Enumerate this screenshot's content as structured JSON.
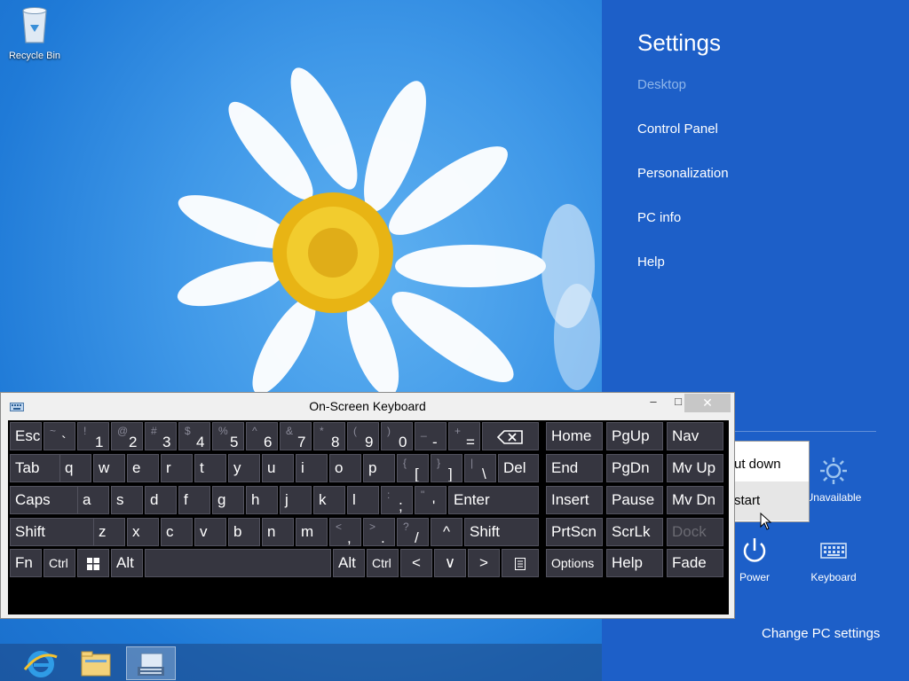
{
  "desktop": {
    "recycle_bin_label": "Recycle Bin"
  },
  "taskbar": {
    "items": [
      {
        "name": "internet-explorer",
        "icon": "ie-icon"
      },
      {
        "name": "file-explorer",
        "icon": "folder-icon"
      },
      {
        "name": "on-screen-keyboard",
        "icon": "keyboard-app-icon",
        "active": true
      }
    ]
  },
  "settings": {
    "title": "Settings",
    "context": "Desktop",
    "links": [
      "Control Panel",
      "Personalization",
      "PC info",
      "Help"
    ],
    "network_label": "Unavailable",
    "power_label": "Power",
    "keyboard_label": "Keyboard",
    "change_pc_settings": "Change PC settings",
    "accent_color": "#1d5fc8"
  },
  "power_menu": {
    "items": [
      "ut down",
      "start"
    ]
  },
  "osk": {
    "title": "On-Screen Keyboard",
    "minimize": "–",
    "maximize": "□",
    "close": "✕",
    "rows": [
      [
        {
          "t": "Esc"
        },
        {
          "s": "~",
          "m": "`"
        },
        {
          "s": "!",
          "m": "1"
        },
        {
          "s": "@",
          "m": "2"
        },
        {
          "s": "#",
          "m": "3"
        },
        {
          "s": "$",
          "m": "4"
        },
        {
          "s": "%",
          "m": "5"
        },
        {
          "s": "^",
          "m": "6"
        },
        {
          "s": "&",
          "m": "7"
        },
        {
          "s": "*",
          "m": "8"
        },
        {
          "s": "(",
          "m": "9"
        },
        {
          "s": ")",
          "m": "0"
        },
        {
          "s": "_",
          "m": "-"
        },
        {
          "s": "+",
          "m": "="
        },
        {
          "icon": "backspace-icon"
        },
        {
          "t": "Home"
        },
        {
          "t": "PgUp"
        },
        {
          "t": "Nav"
        }
      ],
      [
        {
          "t": "Tab"
        },
        {
          "t": "q"
        },
        {
          "t": "w"
        },
        {
          "t": "e"
        },
        {
          "t": "r"
        },
        {
          "t": "t"
        },
        {
          "t": "y"
        },
        {
          "t": "u"
        },
        {
          "t": "i"
        },
        {
          "t": "o"
        },
        {
          "t": "p"
        },
        {
          "s": "{",
          "m": "["
        },
        {
          "s": "}",
          "m": "]"
        },
        {
          "s": "|",
          "m": "\\"
        },
        {
          "t": "Del"
        },
        {
          "t": "End"
        },
        {
          "t": "PgDn"
        },
        {
          "t": "Mv Up"
        }
      ],
      [
        {
          "t": "Caps"
        },
        {
          "t": "a"
        },
        {
          "t": "s"
        },
        {
          "t": "d"
        },
        {
          "t": "f"
        },
        {
          "t": "g"
        },
        {
          "t": "h"
        },
        {
          "t": "j"
        },
        {
          "t": "k"
        },
        {
          "t": "l"
        },
        {
          "s": ":",
          "m": ";"
        },
        {
          "s": "\"",
          "m": "'"
        },
        {
          "t": "Enter"
        },
        {
          "t": "Insert"
        },
        {
          "t": "Pause"
        },
        {
          "t": "Mv Dn"
        }
      ],
      [
        {
          "t": "Shift"
        },
        {
          "t": "z"
        },
        {
          "t": "x"
        },
        {
          "t": "c"
        },
        {
          "t": "v"
        },
        {
          "t": "b"
        },
        {
          "t": "n"
        },
        {
          "t": "m"
        },
        {
          "s": "<",
          "m": ","
        },
        {
          "s": ">",
          "m": "."
        },
        {
          "s": "?",
          "m": "/"
        },
        {
          "c": "^"
        },
        {
          "t": "Shift"
        },
        {
          "t": "PrtScn"
        },
        {
          "t": "ScrLk"
        },
        {
          "t": "Dock",
          "disabled": true
        }
      ],
      [
        {
          "t": "Fn"
        },
        {
          "t": "Ctrl",
          "small": true
        },
        {
          "icon": "windows-logo-icon"
        },
        {
          "t": "Alt"
        },
        {
          "t": ""
        },
        {
          "t": "Alt"
        },
        {
          "t": "Ctrl",
          "small": true
        },
        {
          "c": "<"
        },
        {
          "c": "∨"
        },
        {
          "c": ">"
        },
        {
          "icon": "menu-key-icon"
        },
        {
          "t": "Options",
          "small": true
        },
        {
          "t": "Help"
        },
        {
          "t": "Fade"
        }
      ]
    ]
  }
}
